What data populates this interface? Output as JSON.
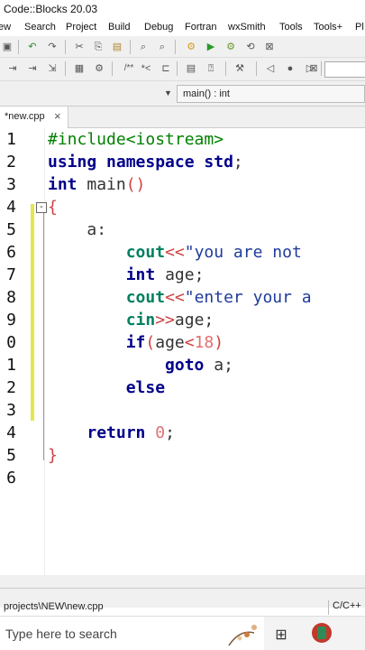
{
  "window": {
    "title": "Code::Blocks 20.03"
  },
  "menu": [
    "ew",
    "Search",
    "Project",
    "Build",
    "Debug",
    "Fortran",
    "wxSmith",
    "Tools",
    "Tools+",
    "Pl"
  ],
  "scope": {
    "function": "main() : int"
  },
  "tab": {
    "label": "*new.cpp",
    "close": "×"
  },
  "editor": {
    "line_numbers": [
      "1",
      "2",
      "3",
      "4",
      "5",
      "6",
      "7",
      "8",
      "9",
      "0",
      "1",
      "2",
      "3",
      "4",
      "5",
      "6"
    ]
  },
  "status": {
    "path": "projects\\NEW\\new.cpp",
    "language": "C/C++"
  },
  "taskbar": {
    "search_placeholder": "Type here to search"
  },
  "icons": {
    "fold": "minus-box-icon",
    "taskview": "task-view-icon",
    "codeblocks": "codeblocks-app-icon"
  }
}
